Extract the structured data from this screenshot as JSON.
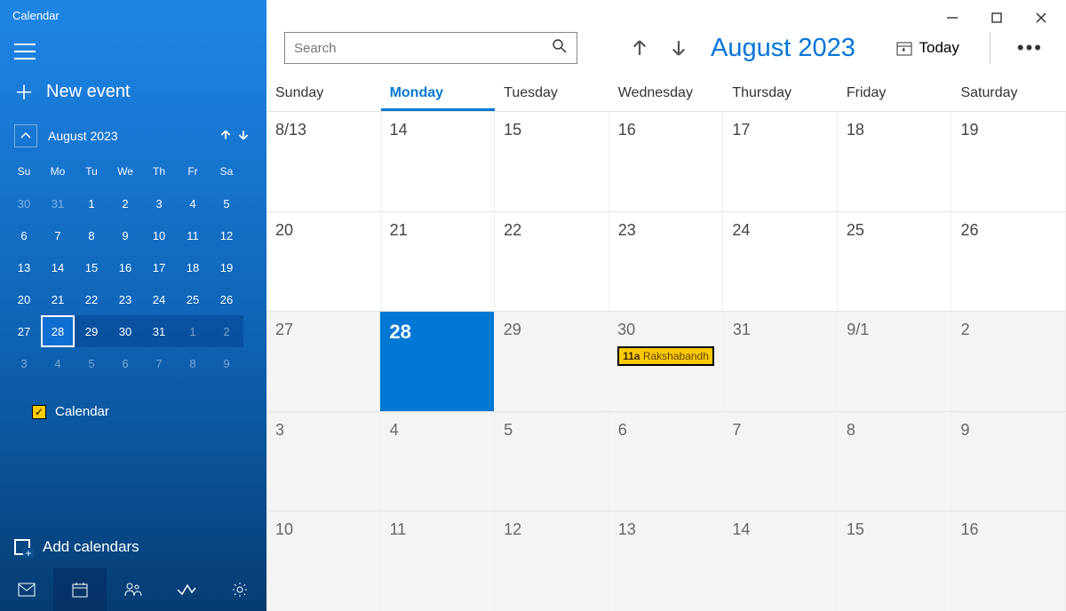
{
  "app_title": "Calendar",
  "sidebar": {
    "new_event": "New event",
    "mini": {
      "label": "August 2023",
      "dow": [
        "Su",
        "Mo",
        "Tu",
        "We",
        "Th",
        "Fr",
        "Sa"
      ],
      "rows": [
        [
          {
            "n": "30",
            "dim": true
          },
          {
            "n": "31",
            "dim": true
          },
          {
            "n": "1"
          },
          {
            "n": "2"
          },
          {
            "n": "3"
          },
          {
            "n": "4"
          },
          {
            "n": "5"
          }
        ],
        [
          {
            "n": "6"
          },
          {
            "n": "7"
          },
          {
            "n": "8"
          },
          {
            "n": "9"
          },
          {
            "n": "10"
          },
          {
            "n": "11"
          },
          {
            "n": "12"
          }
        ],
        [
          {
            "n": "13"
          },
          {
            "n": "14"
          },
          {
            "n": "15"
          },
          {
            "n": "16"
          },
          {
            "n": "17"
          },
          {
            "n": "18"
          },
          {
            "n": "19"
          }
        ],
        [
          {
            "n": "20"
          },
          {
            "n": "21"
          },
          {
            "n": "22"
          },
          {
            "n": "23"
          },
          {
            "n": "24"
          },
          {
            "n": "25"
          },
          {
            "n": "26"
          }
        ],
        [
          {
            "n": "27"
          },
          {
            "n": "28",
            "sel": true
          },
          {
            "n": "29",
            "range": true
          },
          {
            "n": "30",
            "range": true
          },
          {
            "n": "31",
            "range": true
          },
          {
            "n": "1",
            "dim": true,
            "range": true
          },
          {
            "n": "2",
            "dim": true,
            "range": true
          }
        ],
        [
          {
            "n": "3",
            "dim": true
          },
          {
            "n": "4",
            "dim": true
          },
          {
            "n": "5",
            "dim": true
          },
          {
            "n": "6",
            "dim": true
          },
          {
            "n": "7",
            "dim": true
          },
          {
            "n": "8",
            "dim": true
          },
          {
            "n": "9",
            "dim": true
          }
        ]
      ]
    },
    "calendar_item": "Calendar",
    "add_calendars": "Add calendars"
  },
  "main": {
    "search_placeholder": "Search",
    "month_title": "August 2023",
    "today_label": "Today",
    "dow": [
      "Sunday",
      "Monday",
      "Tuesday",
      "Wednesday",
      "Thursday",
      "Friday",
      "Saturday"
    ],
    "dow_active_index": 1,
    "weeks": [
      [
        {
          "n": "8/13"
        },
        {
          "n": "14"
        },
        {
          "n": "15"
        },
        {
          "n": "16"
        },
        {
          "n": "17"
        },
        {
          "n": "18"
        },
        {
          "n": "19"
        }
      ],
      [
        {
          "n": "20"
        },
        {
          "n": "21"
        },
        {
          "n": "22"
        },
        {
          "n": "23"
        },
        {
          "n": "24"
        },
        {
          "n": "25"
        },
        {
          "n": "26"
        }
      ],
      [
        {
          "n": "27",
          "out": true
        },
        {
          "n": "28",
          "sel": true
        },
        {
          "n": "29",
          "out": true
        },
        {
          "n": "30",
          "out": true,
          "event": {
            "time": "11a",
            "title": "Rakshabandh"
          }
        },
        {
          "n": "31",
          "out": true
        },
        {
          "n": "9/1",
          "out": true
        },
        {
          "n": "2",
          "out": true
        }
      ],
      [
        {
          "n": "3",
          "out": true
        },
        {
          "n": "4",
          "out": true
        },
        {
          "n": "5",
          "out": true
        },
        {
          "n": "6",
          "out": true
        },
        {
          "n": "7",
          "out": true
        },
        {
          "n": "8",
          "out": true
        },
        {
          "n": "9",
          "out": true
        }
      ],
      [
        {
          "n": "10",
          "out": true
        },
        {
          "n": "11",
          "out": true
        },
        {
          "n": "12",
          "out": true
        },
        {
          "n": "13",
          "out": true
        },
        {
          "n": "14",
          "out": true
        },
        {
          "n": "15",
          "out": true
        },
        {
          "n": "16",
          "out": true
        }
      ]
    ]
  }
}
